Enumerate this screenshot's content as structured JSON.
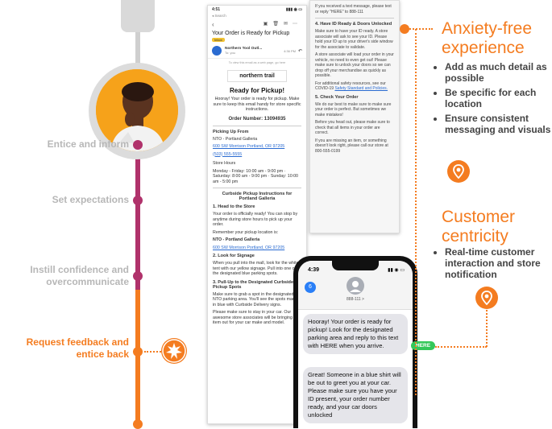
{
  "timeline": {
    "stages": [
      {
        "label": "Entice and inform"
      },
      {
        "label": "Set expectations"
      },
      {
        "label": "Instill confidence and overcommunicate"
      },
      {
        "label": "Request feedback and entice back"
      }
    ]
  },
  "email": {
    "status_time": "4:51",
    "status_back": "◂ Search",
    "subject": "Your Order is Ready for Pickup",
    "inbox_badge": "Inbox",
    "sender": "Northern Tool Outl...",
    "sender_time": "4:36 PM",
    "sender_to": "To: you",
    "view_web": "To view this email as a web page, go here",
    "brand": "northern trail",
    "heading": "Ready for Pickup!",
    "intro": "Hooray! Your order is ready for pickup. Make sure to keep this email handy for store specific instructions.",
    "order_number": "Order Number: 13094935",
    "picking_from": "Picking Up From",
    "store_name": "NTO - Portland Galleria",
    "store_addr": "600 SW Morrison Portland, OR 97205",
    "store_phone": "(503) 555-5555",
    "store_hours_title": "Store Hours",
    "store_hours": "Monday - Friday: 10:00 am - 9:00 pm · Saturday: 8:00 am - 9:00 pm · Sunday: 10:00 am - 5:00 pm",
    "curbside_title": "Curbside Pickup Instructions for Portland Galleria",
    "step1_title": "1. Head to the Store",
    "step1_text": "Your order is officially ready! You can stop by anytime during store hours to pick up your order.",
    "step1_text2": "Remember your pickup location is:",
    "step2_title": "2. Look for Signage",
    "step2_text": "When you pull into the mall, look for the white tent with our yellow signage. Pull into one of the designated blue parking spots.",
    "step3_title": "3. Pull-Up to the Designated Curbside Pickup Spots",
    "step3_text": "Make sure to grab a spot in the designated NTO parking area. You'll see the spots marked in blue with Curbside Delivery signs.",
    "step3_text2": "Please make sure to stay in your car. Our awesome store associates will be bringing an item out for your car make and model."
  },
  "email2": {
    "top_text": "If you received a text message, please text or reply \"HERE\" to 888-111",
    "step4_title": "4. Have ID Ready & Doors Unlocked",
    "step4_text": "Make sure to have your ID ready. A store associate will ask to see your ID. Please hold your ID up to your driver's side window for the associate to validate.",
    "step4_text2": "A store associate will load your order in your vehicle, no need to even get out! Please make sure to unlock your doors so we can drop off your merchandise as quickly as possible.",
    "step4_text3": "For additional safety resources, see our COVID-19",
    "step4_link": "Safety Standard and Policies.",
    "step5_title": "5. Check Your Order",
    "step5_text": "We do our best to make sure to make sure your order is perfect. But sometimes we make mistakes!",
    "step5_text2": "Before you head out, please make sure to check that all items in your order are correct.",
    "step5_text3": "If you are missing an item, or something doesn't look right, please call our store at 800-555-0199"
  },
  "phone": {
    "time": "4:39",
    "back_count": "6",
    "contact": "888-111 >",
    "msg1": "Hooray! Your order is ready for pickup! Look for the designated parking area and reply to this text with HERE when you arrive.",
    "reply": "HERE",
    "msg2": "Great! Someone in a blue shirt will be out to greet you at your car. Please make sure you have your ID present, your order number ready, and your car doors unlocked"
  },
  "right": {
    "section1_title": "Anxiety-free experience",
    "section1_bullets": [
      "Add as much detail as possible",
      "Be specific for each location",
      "Ensure consistent messaging and visuals"
    ],
    "section2_title": "Customer centricity",
    "section2_bullets": [
      "Real-time customer interaction and store notification"
    ]
  },
  "colors": {
    "accent_orange": "#f47c20",
    "accent_magenta": "#b0326b",
    "grey_text": "#b7b7b7",
    "sms_green": "#34c759"
  }
}
